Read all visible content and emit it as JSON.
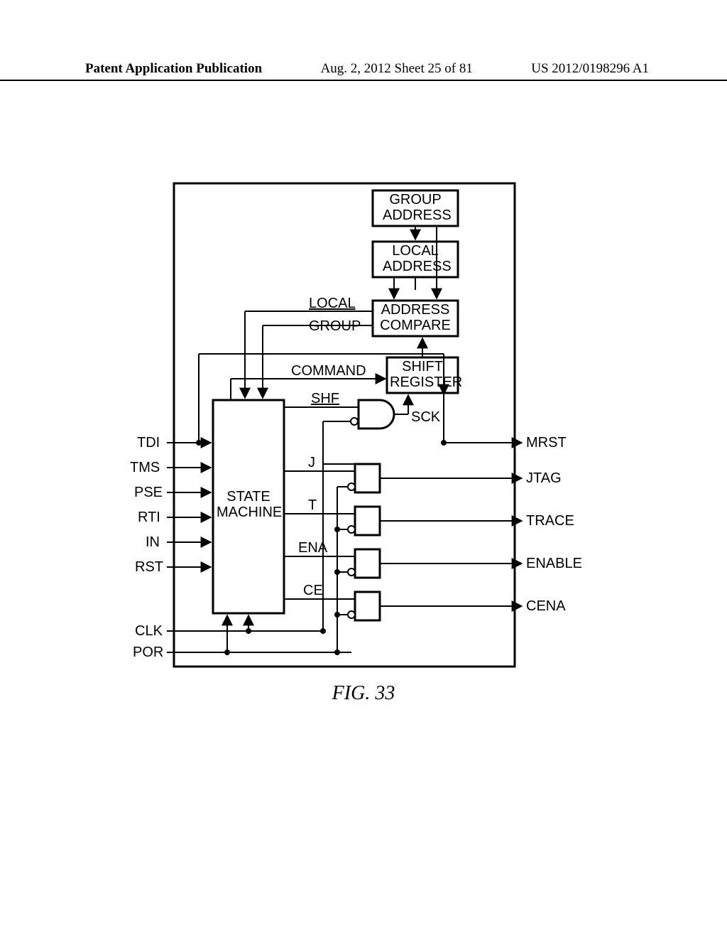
{
  "header": {
    "left": "Patent Application Publication",
    "mid": "Aug. 2, 2012  Sheet 25 of 81",
    "right": "US 2012/0198296 A1"
  },
  "figure_caption": "FIG. 33",
  "blocks": {
    "group_address": "GROUP\nADDRESS",
    "local_address": "LOCAL\nADDRESS",
    "address_compare": "ADDRESS\nCOMPARE",
    "shift_register": "SHIFT\nREGISTER",
    "state_machine": "STATE\nMACHINE"
  },
  "signals": {
    "local": "LOCAL",
    "group": "GROUP",
    "command": "COMMAND",
    "shf": "SHF",
    "sck": "SCK",
    "j": "J",
    "t": "T",
    "ena": "ENA",
    "ce": "CE"
  },
  "inputs": {
    "tdi": "TDI",
    "tms": "TMS",
    "pse": "PSE",
    "rti": "RTI",
    "in": "IN",
    "rst": "RST",
    "clk": "CLK",
    "por": "POR"
  },
  "outputs": {
    "mrst": "MRST",
    "jtag": "JTAG",
    "trace": "TRACE",
    "enable": "ENABLE",
    "cena": "CENA"
  }
}
